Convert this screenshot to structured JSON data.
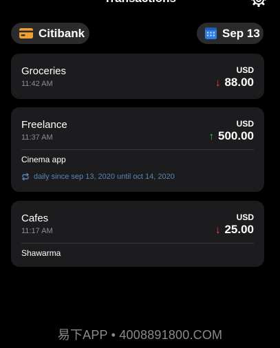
{
  "header": {
    "title": "Transactions",
    "settings_icon": "gear-icon"
  },
  "filters": {
    "bank": {
      "label": "Citibank",
      "icon": "card-icon",
      "icon_color": "#f0a030"
    },
    "date": {
      "label": "Sep 13",
      "icon": "calendar-icon",
      "icon_color": "#2f7fe0"
    }
  },
  "transactions": [
    {
      "name": "Groceries",
      "time": "11:42 AM",
      "currency": "USD",
      "direction": "down",
      "arrow": "↓",
      "amount": "88.00"
    },
    {
      "name": "Freelance",
      "time": "11:37 AM",
      "currency": "USD",
      "direction": "up",
      "arrow": "↑",
      "amount": "500.00",
      "note": "Cinema app",
      "recurrence": "daily since sep 13, 2020 until oct 14, 2020"
    },
    {
      "name": "Cafes",
      "time": "11:17 AM",
      "currency": "USD",
      "direction": "down",
      "arrow": "↓",
      "amount": "25.00",
      "note": "Shawarma"
    }
  ],
  "colors": {
    "background": "#000000",
    "card": "#1c1c1e",
    "expense": "#ff453a",
    "income": "#30d158",
    "recurrence": "#5b86b3"
  },
  "watermark": "易下APP • 4008891800.COM"
}
